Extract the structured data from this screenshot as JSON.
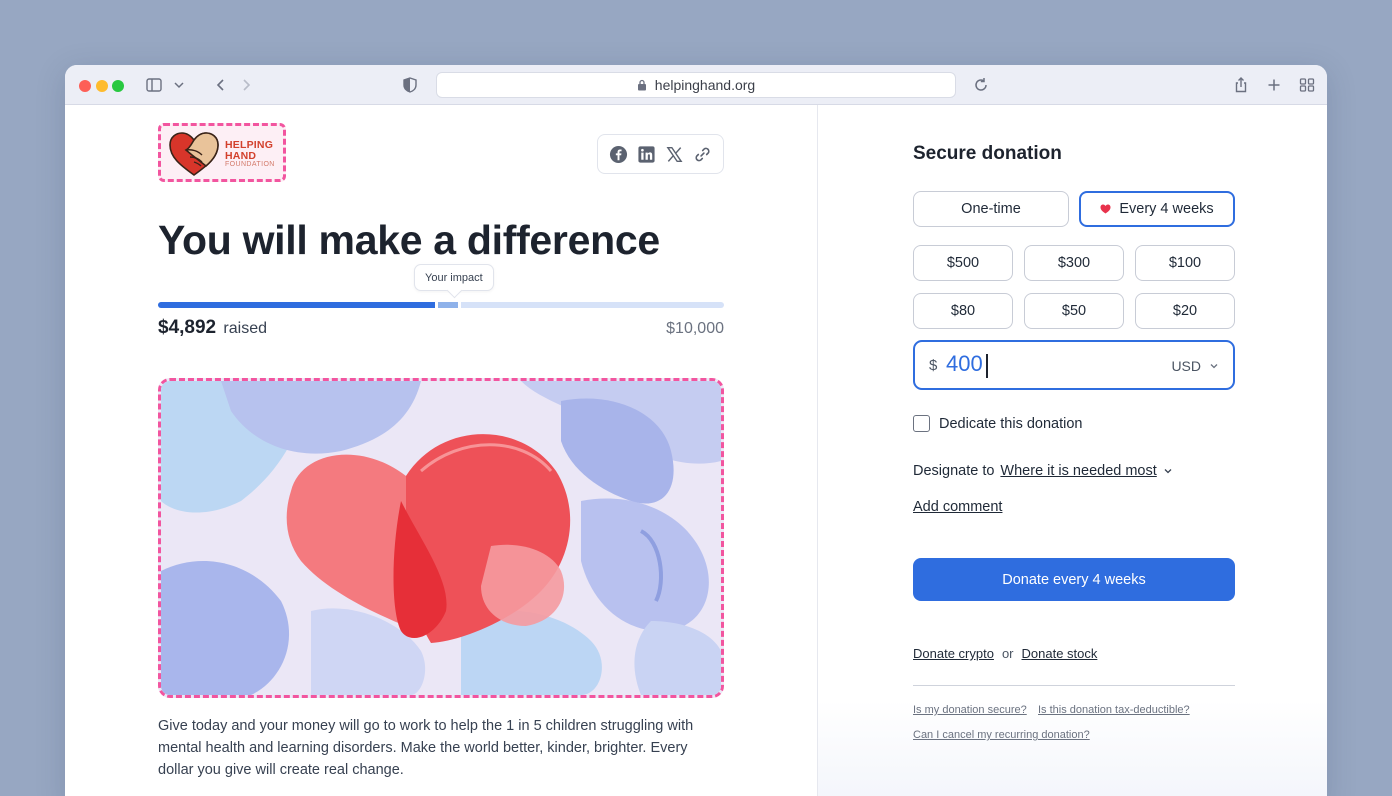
{
  "browser": {
    "url": "helpinghand.org"
  },
  "logo": {
    "line1": "HELPING",
    "line2": "HAND",
    "line3": "FOUNDATION"
  },
  "campaign": {
    "headline": "You will make a difference",
    "tooltip": "Your impact",
    "raised_amount": "$4,892",
    "raised_label": "raised",
    "goal": "$10,000",
    "raised_value": 4892,
    "goal_value": 10000,
    "impact_value": 400,
    "description": "Give today and your money will go to work to help the 1 in 5 children struggling with mental health and learning disorders. Make the world better, kinder, brighter. Every dollar you give will create real change."
  },
  "share": {
    "icons": [
      "facebook-icon",
      "linkedin-icon",
      "x-icon",
      "link-icon"
    ]
  },
  "donation": {
    "title": "Secure donation",
    "frequency": {
      "one_time": "One-time",
      "recurring": "Every 4 weeks",
      "selected": "recurring"
    },
    "amounts": [
      "$500",
      "$300",
      "$100",
      "$80",
      "$50",
      "$20"
    ],
    "input": {
      "currency_symbol": "$",
      "value": "400",
      "currency_code": "USD"
    },
    "dedicate_label": "Dedicate this donation",
    "dedicate_checked": false,
    "designate_label": "Designate to",
    "designate_value": "Where it is needed most",
    "add_comment": "Add comment",
    "donate_button": "Donate every 4 weeks",
    "crypto": "Donate crypto",
    "or": "or",
    "stock": "Donate stock",
    "faq": [
      "Is my donation secure?",
      "Is this donation tax-deductible?",
      "Can I cancel my recurring donation?"
    ]
  },
  "colors": {
    "accent": "#2f6ddf",
    "highlight": "#f2559f",
    "heart": "#e8324c"
  }
}
